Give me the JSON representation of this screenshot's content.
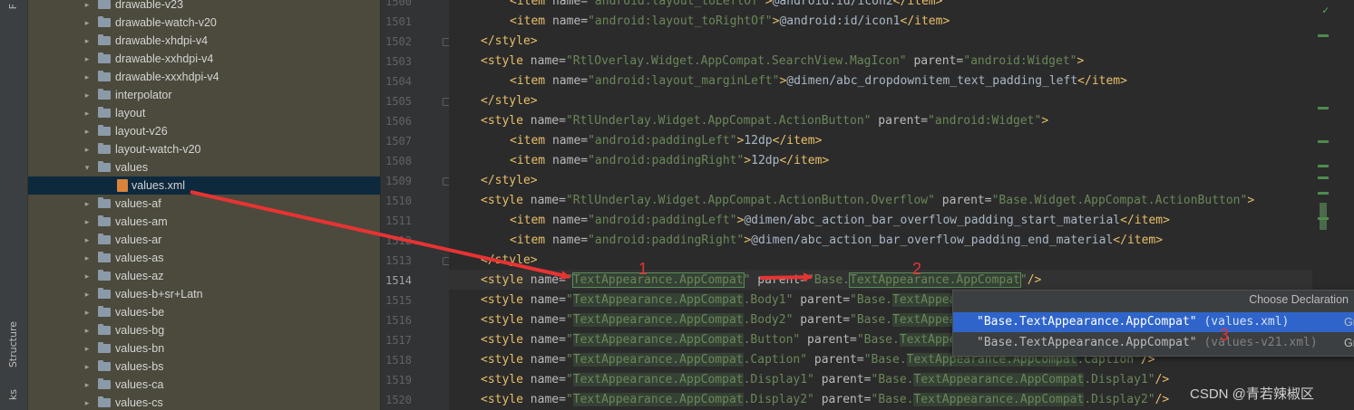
{
  "toolstrip": {
    "structure_label": "Structure",
    "bottom_label": "ks",
    "top_label": "F"
  },
  "tree": {
    "rows": [
      {
        "label": "drawable-v23",
        "type": "folder",
        "expanded": false,
        "selected": false,
        "depth": 1
      },
      {
        "label": "drawable-watch-v20",
        "type": "folder",
        "expanded": false,
        "selected": false,
        "depth": 1
      },
      {
        "label": "drawable-xhdpi-v4",
        "type": "folder",
        "expanded": false,
        "selected": false,
        "depth": 1
      },
      {
        "label": "drawable-xxhdpi-v4",
        "type": "folder",
        "expanded": false,
        "selected": false,
        "depth": 1
      },
      {
        "label": "drawable-xxxhdpi-v4",
        "type": "folder",
        "expanded": false,
        "selected": false,
        "depth": 1
      },
      {
        "label": "interpolator",
        "type": "folder",
        "expanded": false,
        "selected": false,
        "depth": 1
      },
      {
        "label": "layout",
        "type": "folder",
        "expanded": false,
        "selected": false,
        "depth": 1
      },
      {
        "label": "layout-v26",
        "type": "folder",
        "expanded": false,
        "selected": false,
        "depth": 1
      },
      {
        "label": "layout-watch-v20",
        "type": "folder",
        "expanded": false,
        "selected": false,
        "depth": 1
      },
      {
        "label": "values",
        "type": "folder",
        "expanded": true,
        "selected": false,
        "depth": 1
      },
      {
        "label": "values.xml",
        "type": "xml",
        "expanded": false,
        "selected": true,
        "depth": 2
      },
      {
        "label": "values-af",
        "type": "folder",
        "expanded": false,
        "selected": false,
        "depth": 1
      },
      {
        "label": "values-am",
        "type": "folder",
        "expanded": false,
        "selected": false,
        "depth": 1
      },
      {
        "label": "values-ar",
        "type": "folder",
        "expanded": false,
        "selected": false,
        "depth": 1
      },
      {
        "label": "values-as",
        "type": "folder",
        "expanded": false,
        "selected": false,
        "depth": 1
      },
      {
        "label": "values-az",
        "type": "folder",
        "expanded": false,
        "selected": false,
        "depth": 1
      },
      {
        "label": "values-b+sr+Latn",
        "type": "folder",
        "expanded": false,
        "selected": false,
        "depth": 1
      },
      {
        "label": "values-be",
        "type": "folder",
        "expanded": false,
        "selected": false,
        "depth": 1
      },
      {
        "label": "values-bg",
        "type": "folder",
        "expanded": false,
        "selected": false,
        "depth": 1
      },
      {
        "label": "values-bn",
        "type": "folder",
        "expanded": false,
        "selected": false,
        "depth": 1
      },
      {
        "label": "values-bs",
        "type": "folder",
        "expanded": false,
        "selected": false,
        "depth": 1
      },
      {
        "label": "values-ca",
        "type": "folder",
        "expanded": false,
        "selected": false,
        "depth": 1
      },
      {
        "label": "values-cs",
        "type": "folder",
        "expanded": false,
        "selected": false,
        "depth": 1
      }
    ]
  },
  "editor": {
    "current_line": "1514",
    "lines": [
      {
        "num": "1500",
        "indent": 2,
        "fold": false,
        "tokens": [
          [
            "tg",
            "<item "
          ],
          [
            "an",
            "name="
          ],
          [
            "av",
            "\"android:layout_toLeftOf\""
          ],
          [
            "tg",
            ">"
          ],
          [
            "tx",
            "@android:id/icon2"
          ],
          [
            "tg",
            "</item>"
          ]
        ]
      },
      {
        "num": "1501",
        "indent": 2,
        "fold": false,
        "tokens": [
          [
            "tg",
            "<item "
          ],
          [
            "an",
            "name="
          ],
          [
            "av",
            "\"android:layout_toRightOf\""
          ],
          [
            "tg",
            ">"
          ],
          [
            "tx",
            "@android:id/icon1"
          ],
          [
            "tg",
            "</item>"
          ]
        ]
      },
      {
        "num": "1502",
        "indent": 1,
        "fold": true,
        "tokens": [
          [
            "tg",
            "</style>"
          ]
        ]
      },
      {
        "num": "1503",
        "indent": 1,
        "fold": false,
        "tokens": [
          [
            "tg",
            "<style "
          ],
          [
            "an",
            "name="
          ],
          [
            "av",
            "\"RtlOverlay.Widget.AppCompat.SearchView.MagIcon\""
          ],
          [
            "an",
            " parent="
          ],
          [
            "av",
            "\"android:Widget\""
          ],
          [
            "tg",
            ">"
          ]
        ]
      },
      {
        "num": "1504",
        "indent": 2,
        "fold": false,
        "tokens": [
          [
            "tg",
            "<item "
          ],
          [
            "an",
            "name="
          ],
          [
            "av",
            "\"android:layout_marginLeft\""
          ],
          [
            "tg",
            ">"
          ],
          [
            "tx",
            "@dimen/abc_dropdownitem_text_padding_left"
          ],
          [
            "tg",
            "</item>"
          ]
        ]
      },
      {
        "num": "1505",
        "indent": 1,
        "fold": true,
        "tokens": [
          [
            "tg",
            "</style>"
          ]
        ]
      },
      {
        "num": "1506",
        "indent": 1,
        "fold": false,
        "tokens": [
          [
            "tg",
            "<style "
          ],
          [
            "an",
            "name="
          ],
          [
            "av",
            "\"RtlUnderlay.Widget.AppCompat.ActionButton\""
          ],
          [
            "an",
            " parent="
          ],
          [
            "av",
            "\"android:Widget\""
          ],
          [
            "tg",
            ">"
          ]
        ]
      },
      {
        "num": "1507",
        "indent": 2,
        "fold": false,
        "tokens": [
          [
            "tg",
            "<item "
          ],
          [
            "an",
            "name="
          ],
          [
            "av",
            "\"android:paddingLeft\""
          ],
          [
            "tg",
            ">"
          ],
          [
            "tx",
            "12dp"
          ],
          [
            "tg",
            "</item>"
          ]
        ]
      },
      {
        "num": "1508",
        "indent": 2,
        "fold": false,
        "tokens": [
          [
            "tg",
            "<item "
          ],
          [
            "an",
            "name="
          ],
          [
            "av",
            "\"android:paddingRight\""
          ],
          [
            "tg",
            ">"
          ],
          [
            "tx",
            "12dp"
          ],
          [
            "tg",
            "</item>"
          ]
        ]
      },
      {
        "num": "1509",
        "indent": 1,
        "fold": true,
        "tokens": [
          [
            "tg",
            "</style>"
          ]
        ]
      },
      {
        "num": "1510",
        "indent": 1,
        "fold": false,
        "tokens": [
          [
            "tg",
            "<style "
          ],
          [
            "an",
            "name="
          ],
          [
            "av",
            "\"RtlUnderlay.Widget.AppCompat.ActionButton.Overflow\""
          ],
          [
            "an",
            " parent="
          ],
          [
            "av",
            "\"Base.Widget.AppCompat.ActionButton\""
          ],
          [
            "tg",
            ">"
          ]
        ]
      },
      {
        "num": "1511",
        "indent": 2,
        "fold": false,
        "tokens": [
          [
            "tg",
            "<item "
          ],
          [
            "an",
            "name="
          ],
          [
            "av",
            "\"android:paddingLeft\""
          ],
          [
            "tg",
            ">"
          ],
          [
            "tx",
            "@dimen/abc_action_bar_overflow_padding_start_material"
          ],
          [
            "tg",
            "</item>"
          ]
        ]
      },
      {
        "num": "1512",
        "indent": 2,
        "fold": false,
        "tokens": [
          [
            "tg",
            "<item "
          ],
          [
            "an",
            "name="
          ],
          [
            "av",
            "\"android:paddingRight\""
          ],
          [
            "tg",
            ">"
          ],
          [
            "tx",
            "@dimen/abc_action_bar_overflow_padding_end_material"
          ],
          [
            "tg",
            "</item>"
          ]
        ]
      },
      {
        "num": "1513",
        "indent": 1,
        "fold": true,
        "tokens": [
          [
            "tg",
            "</style>"
          ]
        ]
      },
      {
        "num": "1514",
        "indent": 1,
        "fold": false,
        "tokens": [
          [
            "tg",
            "<style "
          ],
          [
            "an",
            "name="
          ],
          [
            "av",
            "\""
          ],
          [
            "av hlb",
            "TextAppearance.AppCompat"
          ],
          [
            "av",
            "\""
          ],
          [
            "an",
            " parent="
          ],
          [
            "av",
            "\"Base."
          ],
          [
            "av hlb",
            "TextAppearance.AppCompat"
          ],
          [
            "av",
            "\""
          ],
          [
            "tg",
            "/>"
          ]
        ]
      },
      {
        "num": "1515",
        "indent": 1,
        "fold": false,
        "tokens": [
          [
            "tg",
            "<style "
          ],
          [
            "an",
            "name="
          ],
          [
            "av",
            "\""
          ],
          [
            "av hl",
            "TextAppearance.AppCompat"
          ],
          [
            "av",
            ".Body1\""
          ],
          [
            "an",
            " parent="
          ],
          [
            "av",
            "\"Base."
          ],
          [
            "av hl",
            "TextAppearance.AppCompat"
          ],
          [
            "av",
            ".Body1\""
          ],
          [
            "tg",
            "/>"
          ]
        ]
      },
      {
        "num": "1516",
        "indent": 1,
        "fold": false,
        "tokens": [
          [
            "tg",
            "<style "
          ],
          [
            "an",
            "name="
          ],
          [
            "av",
            "\""
          ],
          [
            "av hl",
            "TextAppearance.AppCompat"
          ],
          [
            "av",
            ".Body2\""
          ],
          [
            "an",
            " parent="
          ],
          [
            "av",
            "\"Base."
          ],
          [
            "av hl",
            "TextAppearance.AppCompat"
          ],
          [
            "av",
            ".Body2\""
          ],
          [
            "tg",
            "/>"
          ]
        ]
      },
      {
        "num": "1517",
        "indent": 1,
        "fold": false,
        "tokens": [
          [
            "tg",
            "<style "
          ],
          [
            "an",
            "name="
          ],
          [
            "av",
            "\""
          ],
          [
            "av hl",
            "TextAppearance.AppCompat"
          ],
          [
            "av",
            ".Button\""
          ],
          [
            "an",
            " parent="
          ],
          [
            "av",
            "\"Base."
          ],
          [
            "av hl",
            "TextAppearance.AppCompat"
          ],
          [
            "av",
            ".Button\""
          ],
          [
            "tg",
            "/>"
          ]
        ]
      },
      {
        "num": "1518",
        "indent": 1,
        "fold": false,
        "tokens": [
          [
            "tg",
            "<style "
          ],
          [
            "an",
            "name="
          ],
          [
            "av",
            "\""
          ],
          [
            "av hl",
            "TextAppearance.AppCompat"
          ],
          [
            "av",
            ".Caption\""
          ],
          [
            "an",
            " parent="
          ],
          [
            "av",
            "\"Base."
          ],
          [
            "av hl",
            "TextAppearance.AppCompat"
          ],
          [
            "av",
            ".Caption\""
          ],
          [
            "tg",
            "/>"
          ]
        ]
      },
      {
        "num": "1519",
        "indent": 1,
        "fold": false,
        "tokens": [
          [
            "tg",
            "<style "
          ],
          [
            "an",
            "name="
          ],
          [
            "av",
            "\""
          ],
          [
            "av hl",
            "TextAppearance.AppCompat"
          ],
          [
            "av",
            ".Display1\""
          ],
          [
            "an",
            " parent="
          ],
          [
            "av",
            "\"Base."
          ],
          [
            "av hl",
            "TextAppearance.AppCompat"
          ],
          [
            "av",
            ".Display1\""
          ],
          [
            "tg",
            "/>"
          ]
        ]
      },
      {
        "num": "1520",
        "indent": 1,
        "fold": false,
        "tokens": [
          [
            "tg",
            "<style "
          ],
          [
            "an",
            "name="
          ],
          [
            "av",
            "\""
          ],
          [
            "av hl",
            "TextAppearance.AppCompat"
          ],
          [
            "av",
            ".Display2\""
          ],
          [
            "an",
            " parent="
          ],
          [
            "av",
            "\"Base."
          ],
          [
            "av hl",
            "TextAppearance.AppCompat"
          ],
          [
            "av",
            ".Display2\""
          ],
          [
            "tg",
            "/>"
          ]
        ]
      }
    ]
  },
  "popup": {
    "title": "Choose Declaration",
    "items": [
      {
        "name": "\"Base.TextAppearance.AppCompat\"",
        "file": " (values.xml)",
        "right": "Gr",
        "selected": true
      },
      {
        "name": "\"Base.TextAppearance.AppCompat\"",
        "file": " (values-v21.xml)",
        "right": "Gr",
        "selected": false
      }
    ]
  },
  "annotations": {
    "n1": "1",
    "n2": "2",
    "n3": "3",
    "watermark": "CSDN @青若辣椒区",
    "arrow_color": "#e83333"
  },
  "colors": {
    "tag": "#e8bf6a",
    "attr": "#bababa",
    "value": "#6a8759",
    "text": "#a9b7c6",
    "popup_selected": "#2f65ca",
    "tree_bg": "#4c4a3c"
  }
}
